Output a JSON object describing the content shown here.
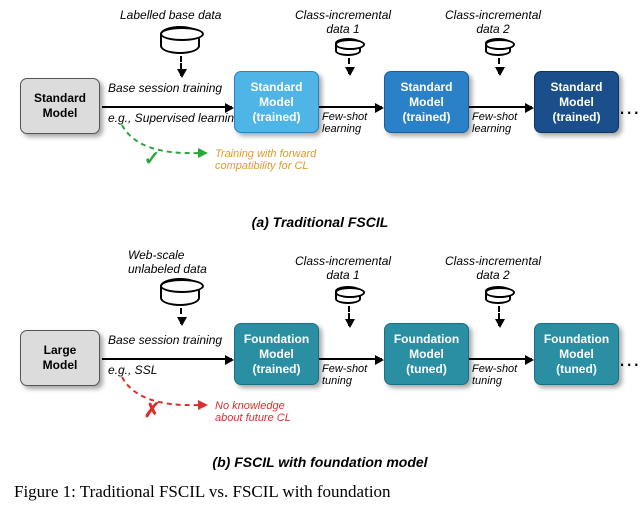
{
  "panel_a": {
    "start_box": "Standard\nModel",
    "db_label": "Labelled base data",
    "arrow1_top": "Base session training",
    "arrow1_bot": "e.g., Supervised learning",
    "trained1": "Standard\nModel\n(trained)",
    "inc_label1": "Class-incremental\ndata 1",
    "arrow2_label": "Few-shot\nlearning",
    "trained2": "Standard\nModel\n(trained)",
    "inc_label2": "Class-incremental\ndata 2",
    "arrow3_label": "Few-shot\nlearning",
    "trained3": "Standard\nModel\n(trained)",
    "note": "Training with forward\ncompatibility for CL",
    "caption": "(a) Traditional FSCIL",
    "check": "✓"
  },
  "panel_b": {
    "start_box": "Large\nModel",
    "db_label": "Web-scale\nunlabeled data",
    "arrow1_top": "Base session training",
    "arrow1_bot": "e.g., SSL",
    "trained1": "Foundation\nModel\n(trained)",
    "inc_label1": "Class-incremental\ndata 1",
    "arrow2_label": "Few-shot\ntuning",
    "trained2": "Foundation\nModel\n(tuned)",
    "inc_label2": "Class-incremental\ndata 2",
    "arrow3_label": "Few-shot\ntuning",
    "trained3": "Foundation\nModel\n(tuned)",
    "note": "No knowledge\nabout future CL",
    "caption": "(b) FSCIL with foundation model",
    "cross": "✗"
  },
  "figure_caption": "Figure 1: Traditional FSCIL vs. FSCIL with foundation",
  "ellipsis": "..."
}
